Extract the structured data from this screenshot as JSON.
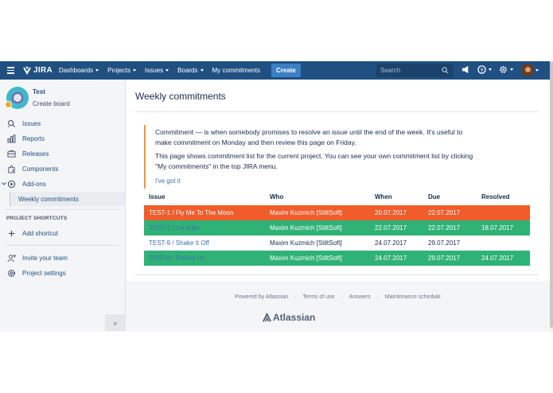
{
  "nav": {
    "logo_text": "JIRA",
    "items": [
      {
        "label": "Dashboards"
      },
      {
        "label": "Projects"
      },
      {
        "label": "Issues"
      },
      {
        "label": "Boards"
      }
    ],
    "my_commitments": "My commitments",
    "create": "Create",
    "search_placeholder": "Search"
  },
  "sidebar": {
    "project_name": "Test",
    "project_sub": "Create board",
    "items": [
      {
        "label": "Issues",
        "icon": "issues-icon"
      },
      {
        "label": "Reports",
        "icon": "reports-icon"
      },
      {
        "label": "Releases",
        "icon": "releases-icon"
      },
      {
        "label": "Components",
        "icon": "components-icon"
      },
      {
        "label": "Add-ons",
        "icon": "addons-icon"
      }
    ],
    "active_sub": "Weekly commitments",
    "shortcuts_heading": "PROJECT SHORTCUTS",
    "add_shortcut": "Add shortcut",
    "invite": "Invite your team",
    "settings": "Project settings",
    "collapse": "«"
  },
  "main": {
    "title": "Weekly commitments",
    "notice_p1": "Commitment — is when somebody promises to resolve an issue until the end of the week. It's useful to make commitment on Monday and then review this page on Friday.",
    "notice_p2": "This page shows commitment list for the current project. You can see your own commitment list by clicking \"My commitments\" in the top JIRA menu.",
    "got_it": "I've got it",
    "columns": {
      "issue": "Issue",
      "who": "Who",
      "when": "When",
      "due": "Due",
      "resolved": "Resolved"
    },
    "rows": [
      {
        "issue": "TEST-1 / Fly Me To The Moon",
        "who": "Maxim Kuzmich [StiltSoft]",
        "when": "20.07.2017",
        "due": "22.07.2017",
        "resolved": "",
        "status": "overdue",
        "bg": "#f15c2b",
        "fg": "#ffffff",
        "link": "#ffffff"
      },
      {
        "issue": "TEST-2 / Let It Be",
        "who": "Maxim Kuzmich [StiltSoft]",
        "when": "22.07.2017",
        "due": "22.07.2017",
        "resolved": "18.07.2017",
        "status": "resolved",
        "bg": "#2fb276",
        "fg": "#ffffff",
        "link": "#3b73af"
      },
      {
        "issue": "TEST-9 / Shake It Off",
        "who": "Maxim Kuzmich [StiltSoft]",
        "when": "24.07.2017",
        "due": "29.07.2017",
        "resolved": "",
        "status": "open",
        "bg": "#ffffff",
        "fg": "#172b4d",
        "link": "#3b73af"
      },
      {
        "issue": "TEST-8 / Deliver Us",
        "who": "Maxim Kuzmich [StiltSoft]",
        "when": "24.07.2017",
        "due": "29.07.2017",
        "resolved": "24.07.2017",
        "status": "resolved",
        "bg": "#2fb276",
        "fg": "#ffffff",
        "link": "#3b73af"
      }
    ]
  },
  "footer": {
    "links": [
      "Powered by Atlassian",
      "Terms of use",
      "Answers",
      "Maintenance schedule"
    ],
    "separator": "·",
    "brand": "Atlassian"
  }
}
